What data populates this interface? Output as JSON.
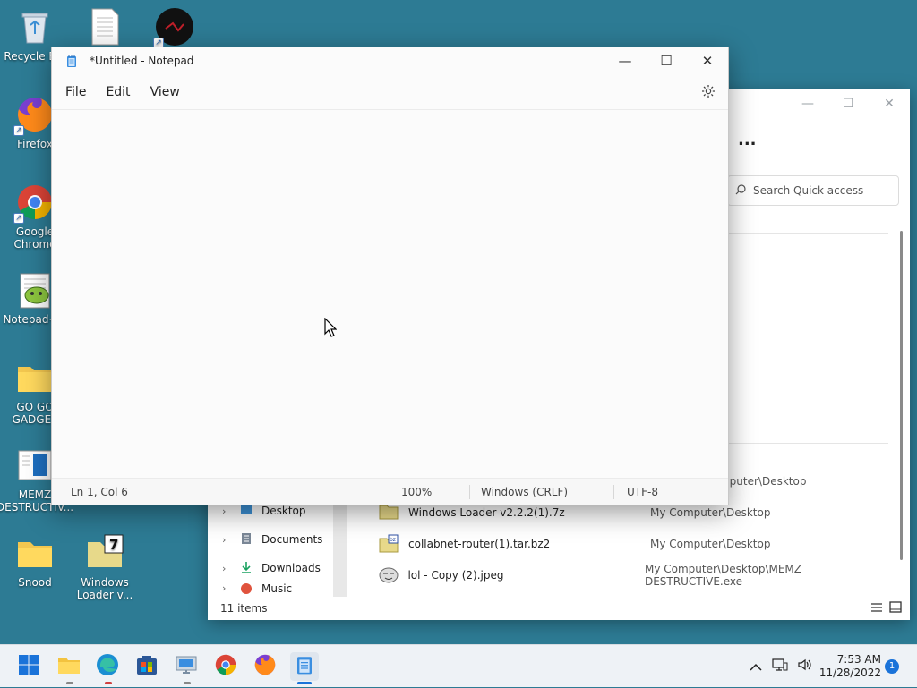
{
  "desktop": {
    "icons": [
      {
        "label": "Recycle Bin",
        "name": "recycle-bin"
      },
      {
        "label": "Firefox",
        "name": "firefox"
      },
      {
        "label": "Google Chrome",
        "name": "google-chrome"
      },
      {
        "label": "Notepad++",
        "name": "notepad-plus-plus"
      },
      {
        "label": "GO GO GADGET",
        "name": "go-go-gadget-folder"
      },
      {
        "label": "MEMZ DESTRUCTIV...",
        "name": "memz-destructive"
      },
      {
        "label": "Snood",
        "name": "snood-folder"
      },
      {
        "label": "Windows Loader v...",
        "name": "windows-loader"
      }
    ]
  },
  "notepad": {
    "title": "*Untitled - Notepad",
    "menu": [
      "File",
      "Edit",
      "View"
    ],
    "content": "",
    "status": {
      "position": "Ln 1, Col 6",
      "zoom": "100%",
      "line_ending": "Windows (CRLF)",
      "encoding": "UTF-8"
    }
  },
  "explorer": {
    "search_placeholder": "Search Quick access",
    "more_label": "...",
    "nav": [
      "Desktop",
      "Documents",
      "Downloads",
      "Music"
    ],
    "files": [
      {
        "name": "",
        "location": "My Computer\\Desktop"
      },
      {
        "name": "Windows Loader v2.2.2(1).7z",
        "location": "My Computer\\Desktop"
      },
      {
        "name": "collabnet-router(1).tar.bz2",
        "location": "My Computer\\Desktop"
      },
      {
        "name": "lol - Copy (2).jpeg",
        "location": "My Computer\\Desktop\\MEMZ DESTRUCTIVE.exe"
      }
    ],
    "item_count": "11 items"
  },
  "taskbar": {
    "time": "7:53 AM",
    "date": "11/28/2022",
    "notification_count": "1"
  }
}
